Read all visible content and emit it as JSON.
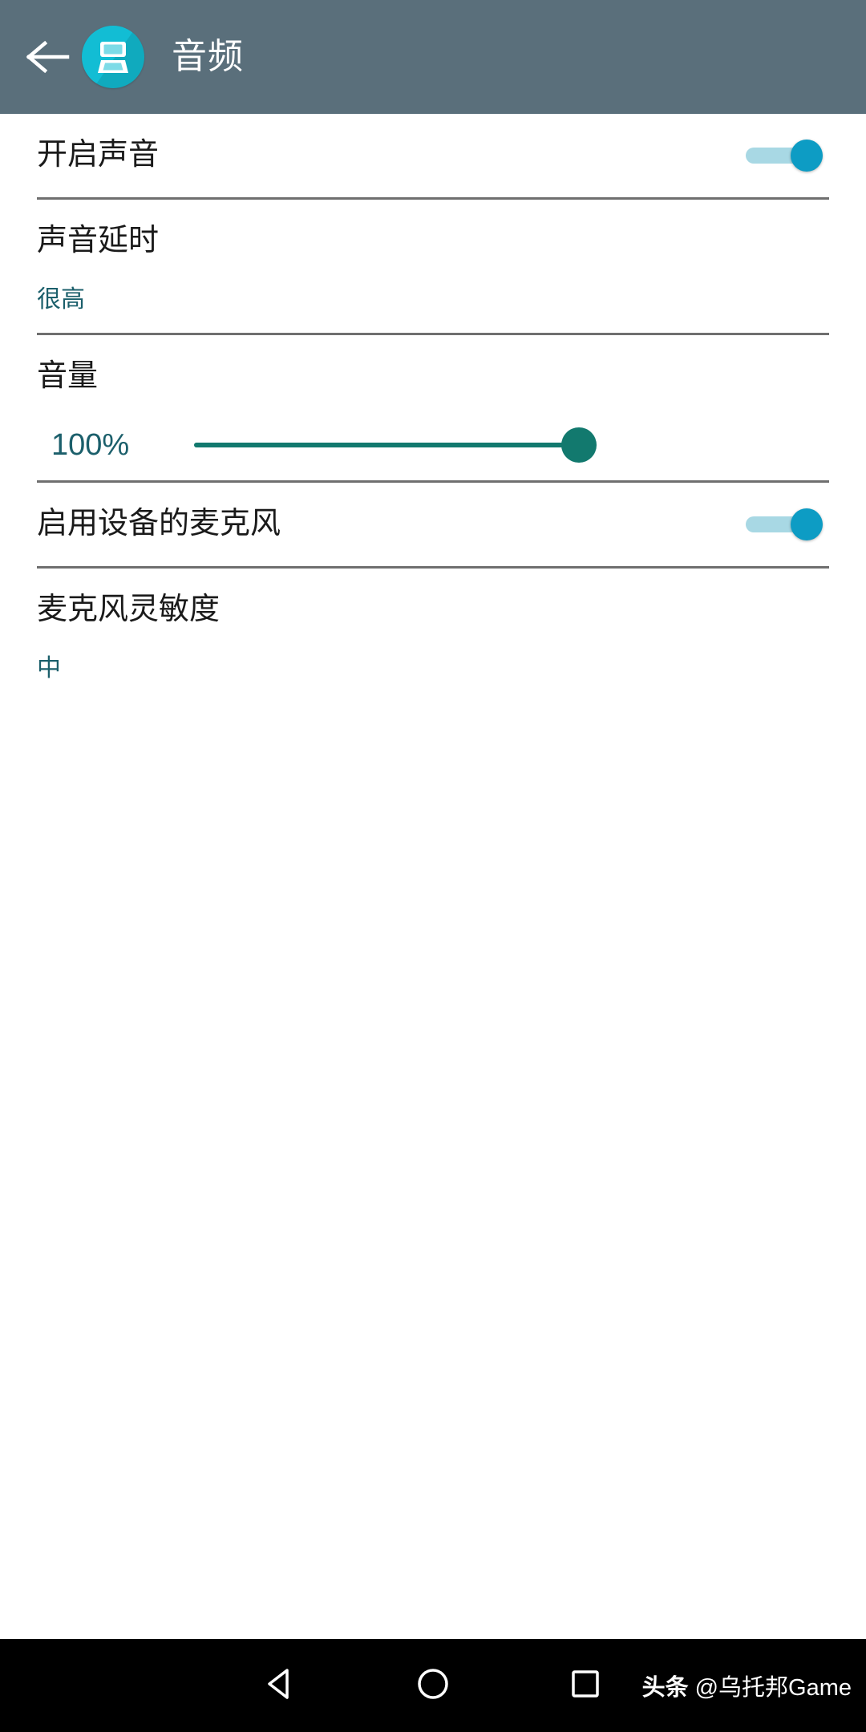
{
  "appbar": {
    "back_icon": "arrow-left-icon",
    "app_icon": "dual-screen-handheld-icon",
    "title": "音频",
    "bg_color": "#5a6f7b",
    "icon_color": "#12bdd4",
    "title_color": "#ffffff"
  },
  "theme": {
    "accent_teal": "#12796e",
    "value_text": "#1b5f6b",
    "toggle_track": "#a8d8e4",
    "toggle_thumb": "#0d9cc4",
    "divider": "#6f6f6f",
    "title_text": "#1a1a1a"
  },
  "settings": [
    {
      "type": "toggle",
      "name": "enable-sound",
      "title": "开启声音",
      "checked": true
    },
    {
      "type": "value",
      "name": "audio-latency",
      "title": "声音延时",
      "value": "很高"
    },
    {
      "type": "slider",
      "name": "volume",
      "title": "音量",
      "value_label": "100%",
      "percent": 100,
      "min": 0,
      "max": 100
    },
    {
      "type": "toggle",
      "name": "enable-device-microphone",
      "title": "启用设备的麦克风",
      "checked": true
    },
    {
      "type": "value",
      "name": "microphone-sensitivity",
      "title": "麦克风灵敏度",
      "value": "中"
    }
  ],
  "navbar": {
    "back_icon": "triangle-back-icon",
    "home_icon": "circle-home-icon",
    "recents_icon": "square-recents-icon",
    "watermark_logo": "头条",
    "watermark_text": "@乌托邦Game",
    "bg_color": "#000000"
  }
}
